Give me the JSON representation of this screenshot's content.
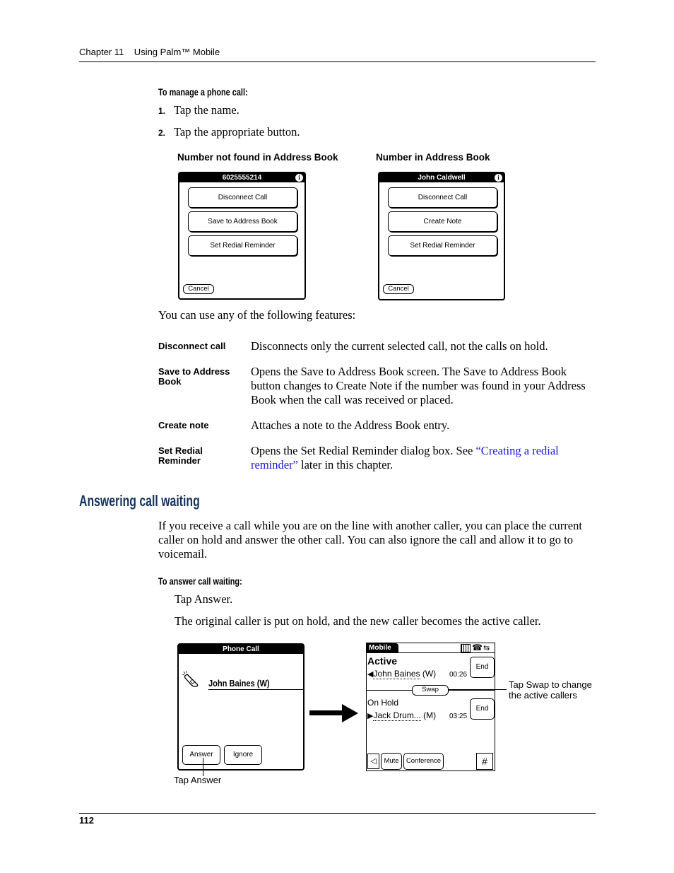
{
  "header": {
    "running_title": "Chapter 11    Using Palm™ Mobile"
  },
  "manage_call": {
    "heading": "To manage a phone call:",
    "steps": [
      {
        "num": "1.",
        "text": "Tap the name."
      },
      {
        "num": "2.",
        "text": "Tap the appropriate button."
      }
    ]
  },
  "figures": {
    "not_found": {
      "caption": "Number not found in Address Book",
      "title": "6025555214",
      "buttons": [
        "Disconnect Call",
        "Save to Address Book",
        "Set Redial Reminder"
      ],
      "cancel": "Cancel"
    },
    "found": {
      "caption": "Number in Address Book",
      "title": "John Caldwell",
      "buttons": [
        "Disconnect Call",
        "Create Note",
        "Set Redial Reminder"
      ],
      "cancel": "Cancel"
    },
    "info_glyph": "i"
  },
  "features": {
    "intro": "You can use any of the following features:",
    "items": [
      {
        "term": "Disconnect call",
        "definition": "Disconnects only the current selected call, not the calls on hold."
      },
      {
        "term": "Save to Address Book",
        "definition": "Opens the Save to Address Book screen. The Save to Address Book button changes to Create Note if the number was found in your Address Book when the call was received or placed."
      },
      {
        "term": "Create note",
        "definition": "Attaches a note to the Address Book entry."
      },
      {
        "term": "Set Redial Reminder",
        "definition_before": "Opens the Set Redial Reminder dialog box. See ",
        "link": "“Creating a redial reminder”",
        "definition_after": " later in this chapter."
      }
    ]
  },
  "call_waiting": {
    "heading": "Answering call waiting",
    "intro": "If you receive a call while you are on the line with another caller, you can place the current caller on hold and answer the other call. You can also ignore the call and allow it to go to voicemail.",
    "proc_heading": "To answer call waiting:",
    "step": "Tap Answer.",
    "result": "The original caller is put on hold, and the new caller becomes the active caller.",
    "incoming_screen": {
      "title": "Phone Call",
      "caller": "John Baines (W)",
      "buttons": [
        "Answer",
        "Ignore"
      ],
      "callout": "Tap Answer"
    },
    "mobile_screen": {
      "tab": "Mobile",
      "active_label": "Active",
      "active_caller": "John Baines",
      "active_type": "(W)",
      "active_time": "00:26",
      "end_label": "End",
      "swap_label": "Swap",
      "hold_label": "On Hold",
      "hold_caller": "Jack Drum...",
      "hold_type": "(M)",
      "hold_time": "03:25",
      "bottom_buttons": [
        "Mute",
        "Conference"
      ],
      "keypad_label": "#",
      "callout": "Tap Swap to change the active callers"
    }
  },
  "footer": {
    "page_number": "112"
  }
}
